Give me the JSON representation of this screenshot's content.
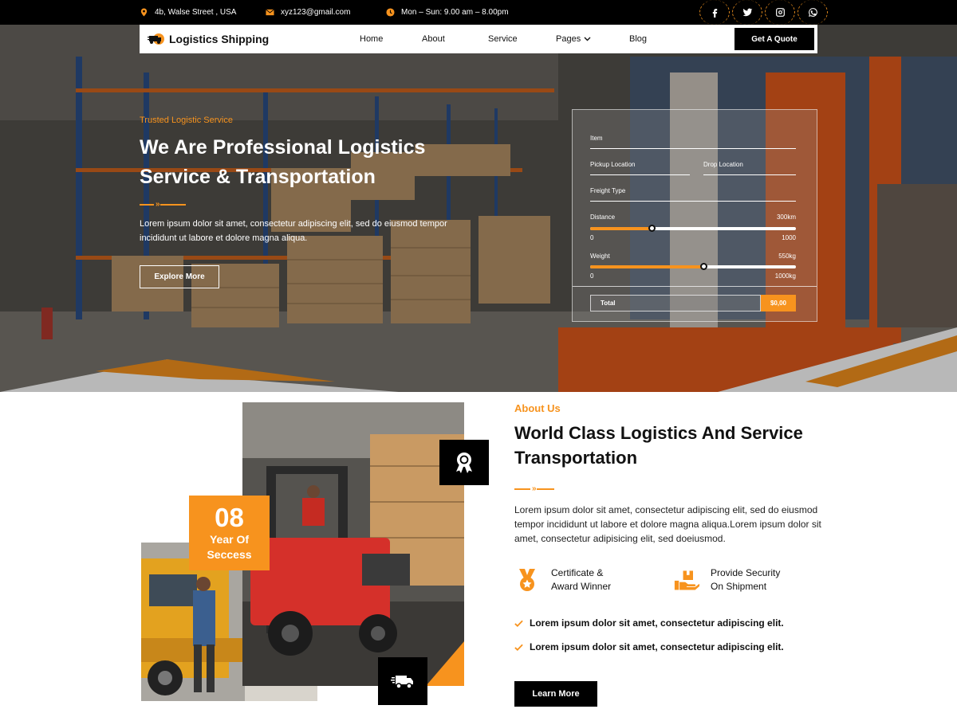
{
  "topbar": {
    "address": "4b, Walse Street , USA",
    "email": "xyz123@gmail.com",
    "hours": "Mon – Sun: 9.00 am – 8.00pm",
    "socials": [
      "facebook-icon",
      "twitter-icon",
      "instagram-icon",
      "whatsapp-icon"
    ]
  },
  "nav": {
    "brand": "Logistics Shipping",
    "links": [
      "Home",
      "About",
      "Service",
      "Pages",
      "Blog"
    ],
    "cta": "Get A Quote"
  },
  "hero": {
    "tagline": "Trusted Logistic Service",
    "title": "We Are Professional Logistics Service & Transportation",
    "description": "Lorem ipsum dolor sit amet, consectetur adipiscing elit, sed do eiusmod tempor incididunt ut labore et dolore magna aliqua.",
    "button": "Explore More"
  },
  "calculator": {
    "item_label": "Item",
    "pickup_label": "Pickup Location",
    "drop_label": "Drop Location",
    "freight_label": "Freight Type",
    "distance": {
      "label": "Distance",
      "value": "300km",
      "min": "0",
      "max": "1000",
      "fraction": 0.3
    },
    "weight": {
      "label": "Weight",
      "value": "550kg",
      "min": "0",
      "max": "1000kg",
      "fraction": 0.55
    },
    "total_label": "Total",
    "total_value": "$0,00"
  },
  "about": {
    "years_number": "08",
    "years_label": "Year Of Seccess",
    "tag": "About Us",
    "title": "World Class Logistics And Service Transportation",
    "description": "Lorem ipsum dolor sit amet, consectetur adipiscing elit, sed do eiusmod tempor incididunt ut labore et dolore magna aliqua.Lorem  ipsum dolor sit amet, consectetur adipisicing elit, sed doeiusmod.",
    "features": [
      {
        "icon": "medal-icon",
        "line1": "Certificate &",
        "line2": "Award Winner"
      },
      {
        "icon": "hand-box-icon",
        "line1": "Provide Security",
        "line2": "On Shipment"
      }
    ],
    "checks": [
      "Lorem ipsum dolor sit amet, consectetur adipiscing elit.",
      "Lorem ipsum dolor sit amet, consectetur adipiscing elit."
    ],
    "button": "Learn More"
  },
  "colors": {
    "accent": "#f7931e",
    "dark": "#000000",
    "text": "#111111"
  }
}
